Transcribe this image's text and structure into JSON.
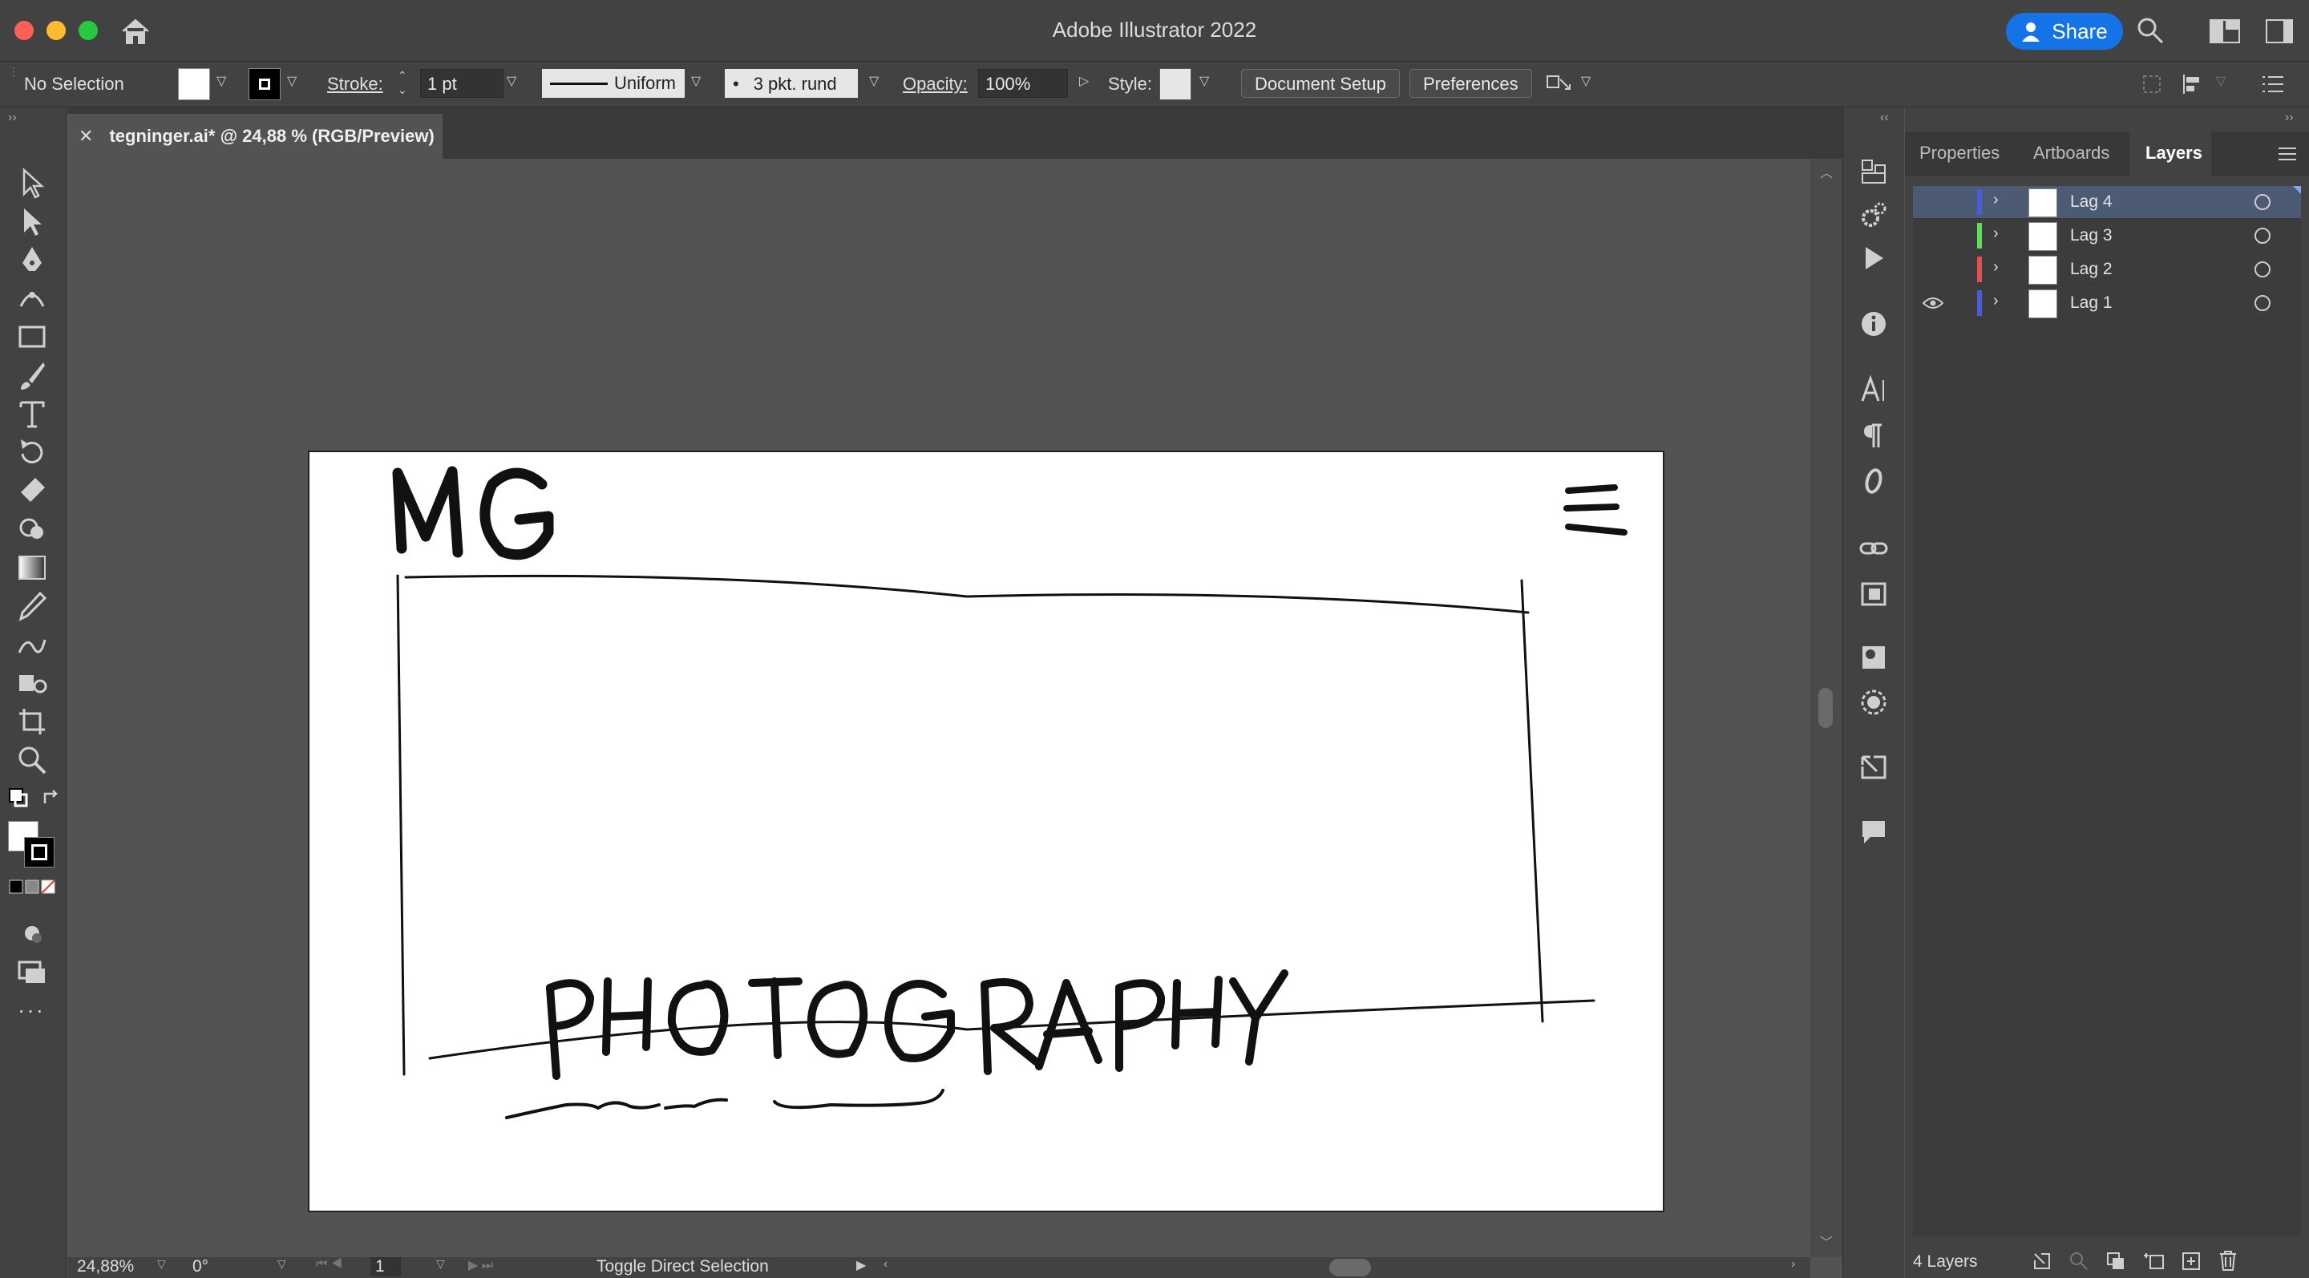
{
  "window": {
    "title": "Adobe Illustrator 2022",
    "share_label": "Share"
  },
  "control_bar": {
    "selection": "No Selection",
    "stroke_label": "Stroke:",
    "stroke_value": "1 pt",
    "profile": "Uniform",
    "brush": "3 pkt. rund",
    "opacity_label": "Opacity:",
    "opacity_value": "100%",
    "style_label": "Style:",
    "document_setup": "Document Setup",
    "preferences": "Preferences"
  },
  "document": {
    "tab_title": "tegninger.ai* @ 24,88 % (RGB/Preview)"
  },
  "status": {
    "zoom": "24,88%",
    "rotation": "0°",
    "artboard": "1",
    "message": "Toggle Direct Selection"
  },
  "panel": {
    "tabs": [
      "Properties",
      "Artboards",
      "Layers"
    ],
    "active_tab": "Layers",
    "layers": [
      {
        "name": "Lag 4",
        "color": "#4a5bdc",
        "visible": false,
        "selected": true
      },
      {
        "name": "Lag 3",
        "color": "#5be05b",
        "visible": false,
        "selected": false
      },
      {
        "name": "Lag 2",
        "color": "#e05050",
        "visible": false,
        "selected": false
      },
      {
        "name": "Lag 1",
        "color": "#4a5bdc",
        "visible": true,
        "selected": false
      }
    ],
    "layer_count": "4 Layers"
  },
  "colors": {
    "accent": "#1473e6",
    "chrome": "#424242",
    "canvas": "#535353"
  }
}
